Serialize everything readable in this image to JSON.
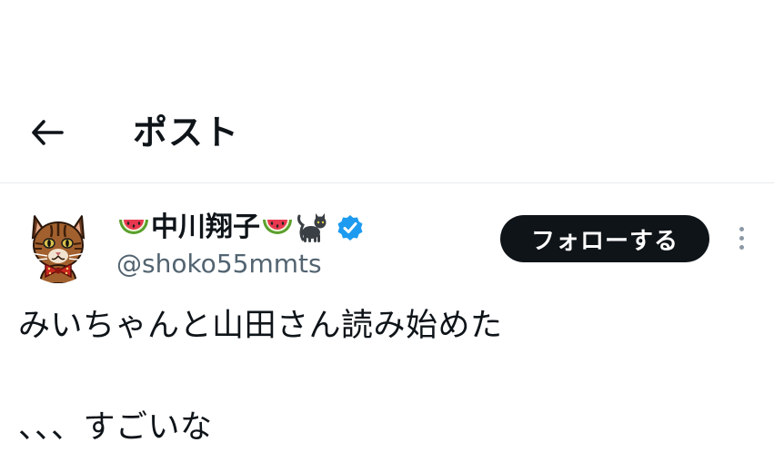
{
  "header": {
    "title": "ポスト",
    "back_icon": "back-arrow-icon"
  },
  "post": {
    "author": {
      "display_name": "中川翔子",
      "handle": "@shoko55mmts",
      "leading_emoji": "watermelon-icon",
      "trailing_emojis": [
        "watermelon-icon",
        "black-cat-icon"
      ],
      "verified_icon": "verified-badge-icon",
      "verified_color": "#1d9bf0"
    },
    "follow_button": {
      "label": "フォローする",
      "bg_color": "#0f1419",
      "text_color": "#ffffff"
    },
    "more_icon": "more-vertical-icon",
    "text_lines": [
      "みいちゃんと山田さん読み始めた",
      "、、、すごいな"
    ]
  }
}
